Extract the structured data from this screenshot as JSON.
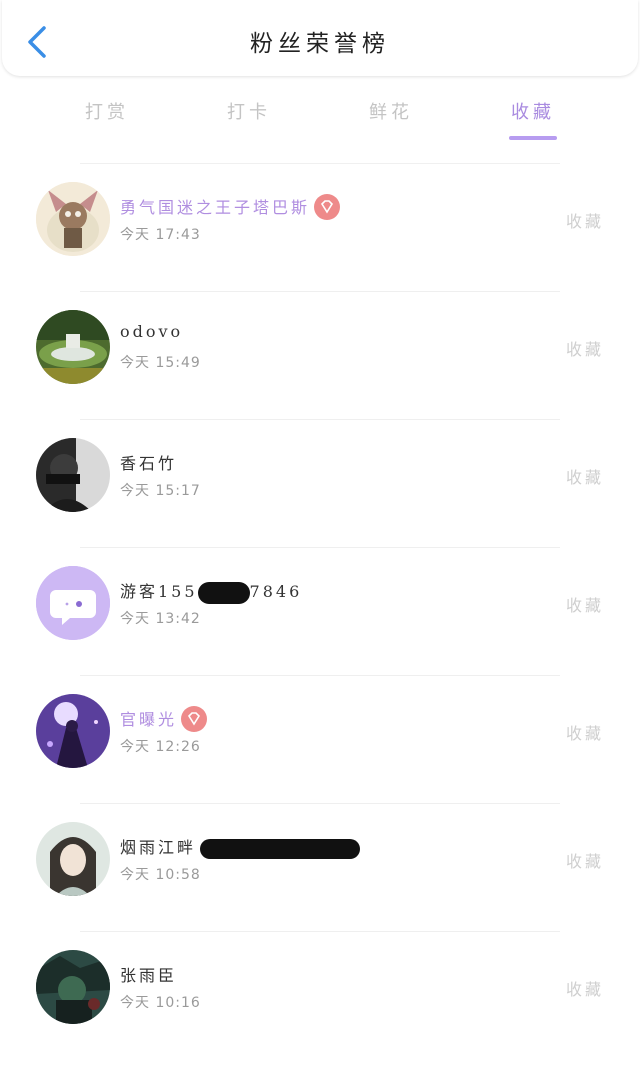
{
  "header": {
    "title": "粉丝荣誉榜"
  },
  "tabs": [
    {
      "label": "打赏",
      "active": false
    },
    {
      "label": "打卡",
      "active": false
    },
    {
      "label": "鲜花",
      "active": false
    },
    {
      "label": "收藏",
      "active": true
    }
  ],
  "rows": [
    {
      "name": "勇气国迷之王子塔巴斯",
      "vip": true,
      "time": "今天 17:43",
      "action": "收藏"
    },
    {
      "name": "odovo",
      "vip": false,
      "time": "今天 15:49",
      "action": "收藏"
    },
    {
      "name": "香石竹",
      "vip": false,
      "time": "今天 15:17",
      "action": "收藏"
    },
    {
      "name_prefix": "游客155",
      "name_suffix": "7846",
      "vip": false,
      "time": "今天 13:42",
      "action": "收藏"
    },
    {
      "name": "官曝光",
      "vip": true,
      "time": "今天 12:26",
      "action": "收藏"
    },
    {
      "name": "烟雨江畔",
      "vip": false,
      "time": "今天 10:58",
      "action": "收藏"
    },
    {
      "name": "张雨臣",
      "vip": false,
      "time": "今天 10:16",
      "action": "收藏"
    }
  ],
  "colors": {
    "accent": "#b79cf0",
    "vip_name": "#b08ee0",
    "badge": "#ee8a8a"
  },
  "icons": {
    "back": "chevron-left-icon",
    "badge": "diamond-icon"
  }
}
